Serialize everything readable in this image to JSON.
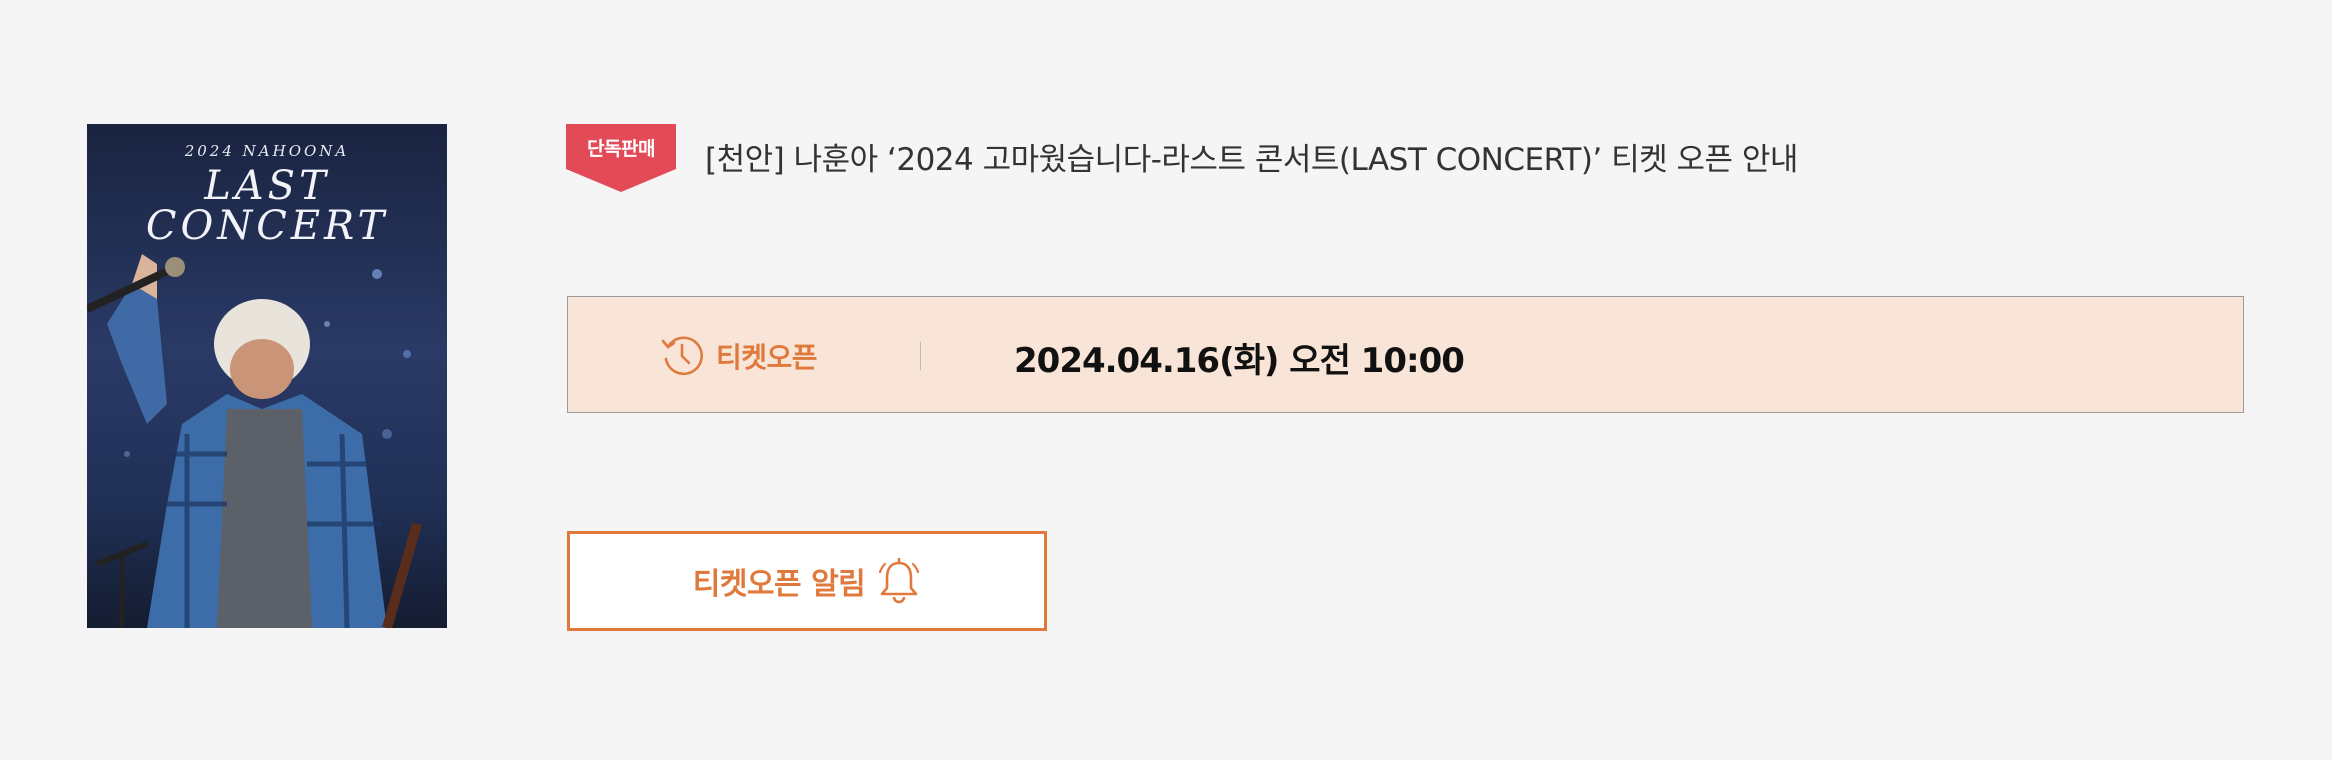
{
  "poster": {
    "year_text": "2024 NAHOONA",
    "title_text": "LAST\nCONCERT"
  },
  "badge": {
    "label": "단독판매",
    "color": "#e24a57"
  },
  "event": {
    "title": "[천안] 나훈아 ‘2024 고마웠습니다-라스트 콘서트(LAST CONCERT)’ 티켓 오픈 안내"
  },
  "ticket_open": {
    "icon": "history-clock-icon",
    "label": "티켓오픈",
    "datetime": "2024.04.16(화) 오전 10:00"
  },
  "alarm_button": {
    "label": "티켓오픈 알림",
    "icon": "bell-icon",
    "accent": "#e07a3c"
  }
}
